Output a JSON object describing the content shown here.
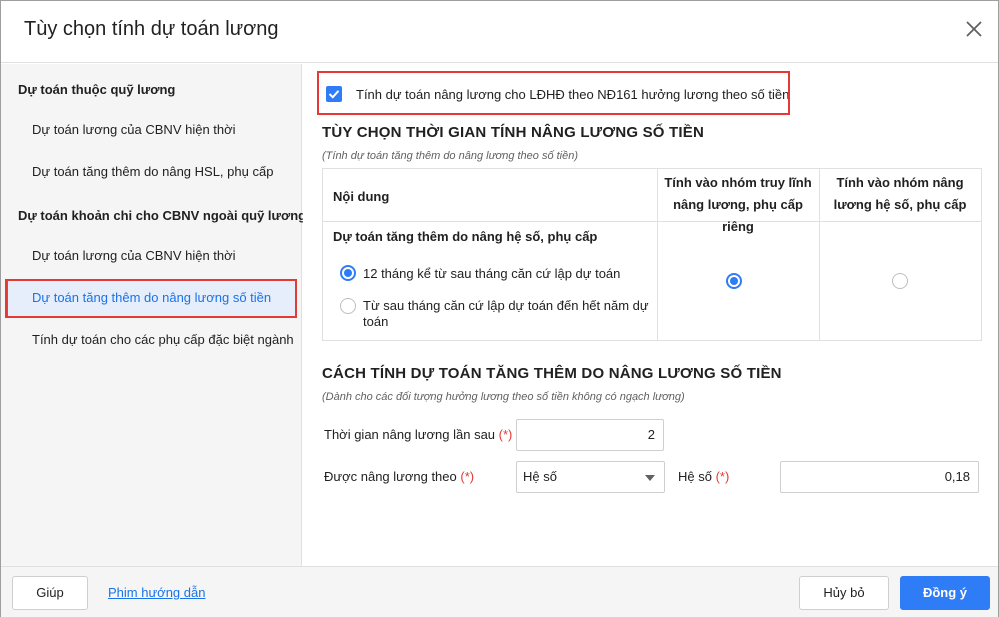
{
  "dialog": {
    "title": "Tùy chọn tính dự toán lương"
  },
  "sidebar": {
    "groups": [
      {
        "label": "Dự toán thuộc quỹ lương",
        "items": [
          {
            "label": "Dự toán lương của CBNV hiện thời"
          },
          {
            "label": "Dự toán tăng thêm do nâng HSL, phụ cấp"
          }
        ]
      },
      {
        "label": "Dự toán khoản chi cho CBNV ngoài quỹ lương",
        "items": [
          {
            "label": "Dự toán lương của CBNV hiện thời"
          },
          {
            "label": "Dự toán tăng thêm do nâng lương số tiền",
            "active": true
          },
          {
            "label": "Tính dự toán cho các phụ cấp đặc biệt ngành"
          }
        ]
      }
    ]
  },
  "main": {
    "option_checkbox": {
      "label": "Tính dự toán nâng lương cho LĐHĐ theo NĐ161 hưởng lương theo số tiền",
      "checked": true
    },
    "section1": {
      "title": "TÙY CHỌN THỜI GIAN TÍNH NÂNG LƯƠNG SỐ TIỀN",
      "subtitle": "(Tính dự toán tăng thêm do nâng lương theo số tiền)",
      "table": {
        "col_content": "Nội dung",
        "col_group1": "Tính vào nhóm truy lĩnh nâng lương, phụ cấp riêng",
        "col_group2": "Tính vào nhóm nâng lương hệ số, phụ cấp",
        "row_title": "Dự toán tăng thêm do nâng hệ số, phụ cấp",
        "option1": "12 tháng kể từ sau tháng căn cứ lập dự toán",
        "option2": "Từ sau tháng căn cứ lập dự toán đến hết năm dự toán",
        "option_selected": 1,
        "group_selected": 1
      }
    },
    "section2": {
      "title": "CÁCH TÍNH DỰ TOÁN TĂNG THÊM DO NÂNG LƯƠNG SỐ TIỀN",
      "subtitle": "(Dành cho các đối tượng hưởng lương theo số tiền không có ngạch lương)",
      "next_raise_label": "Thời gian nâng lương lần sau",
      "next_raise_value": "2",
      "raise_by_label": "Được nâng lương theo",
      "raise_by_value": "Hệ số",
      "coef_label": "Hệ số",
      "coef_value": "0,18",
      "required_mark": "(*)"
    }
  },
  "footer": {
    "help_label": "Giúp",
    "guide_link": "Phim hướng dẫn",
    "cancel_label": "Hủy bỏ",
    "ok_label": "Đồng ý"
  },
  "colors": {
    "accent": "#2e7cf6",
    "highlight_border": "#e53935",
    "required": "#e53935"
  }
}
